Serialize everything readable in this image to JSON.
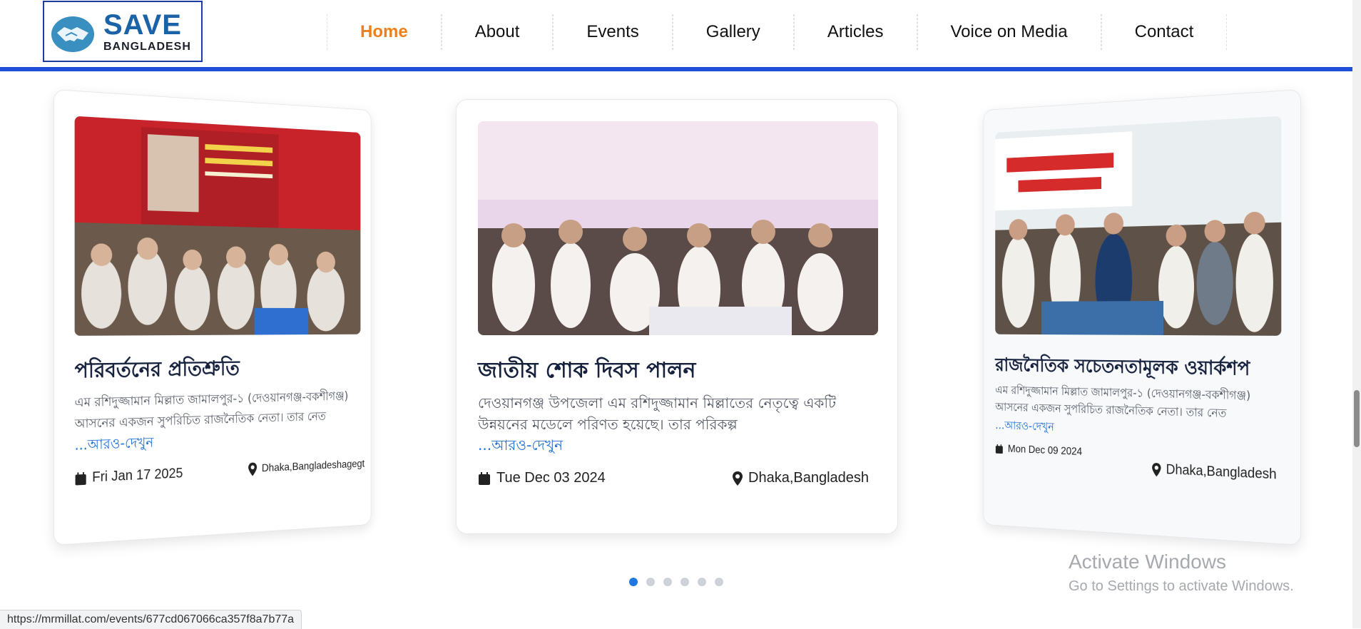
{
  "logo": {
    "title": "SAVE",
    "subtitle": "BANGLADESH"
  },
  "nav": [
    "Home",
    "About",
    "Events",
    "Gallery",
    "Articles",
    "Voice on Media",
    "Contact"
  ],
  "events": [
    {
      "title": "পরিবর্তনের প্রতিশ্রুতি",
      "desc": "এম রশিদুজ্জামান মিল্লাত জামালপুর-১ (দেওয়ানগঞ্জ-বকশীগঞ্জ) আসনের একজন সুপরিচিত রাজনৈতিক নেতা। তার নেত",
      "more": "...আরও-দেখুন",
      "date": "Fri Jan 17 2025",
      "location": "Dhaka,Bangladeshagegt"
    },
    {
      "title": "জাতীয় শোক দিবস পালন",
      "desc": "দেওয়ানগঞ্জ উপজেলা এম রশিদুজ্জামান মিল্লাতের নেতৃত্বে একটি উন্নয়নের মডেলে পরিণত হয়েছে। তার পরিকল্প",
      "more": "...আরও-দেখুন",
      "date": "Tue Dec 03 2024",
      "location": "Dhaka,Bangladesh"
    },
    {
      "title": "রাজনৈতিক সচেতনতামূলক ওয়ার্কশপ",
      "desc": "এম রশিদুজ্জামান মিল্লাত জামালপুর-১ (দেওয়ানগঞ্জ-বকশীগঞ্জ) আসনের একজন সুপরিচিত রাজনৈতিক নেতা। তার নেত",
      "more": "...আরও-দেখুন",
      "date": "Mon Dec 09 2024",
      "location": "Dhaka,Bangladesh"
    }
  ],
  "carousel": {
    "dot_count": 6,
    "active_index": 0
  },
  "watermark": {
    "line1": "Activate Windows",
    "line2": "Go to Settings to activate Windows."
  },
  "status_url": "https://mrmillat.com/events/677cd067066ca357f8a7b77a",
  "colors": {
    "accent": "#f07f1b",
    "brand": "#1f4fd8",
    "link": "#1f6fd6"
  }
}
